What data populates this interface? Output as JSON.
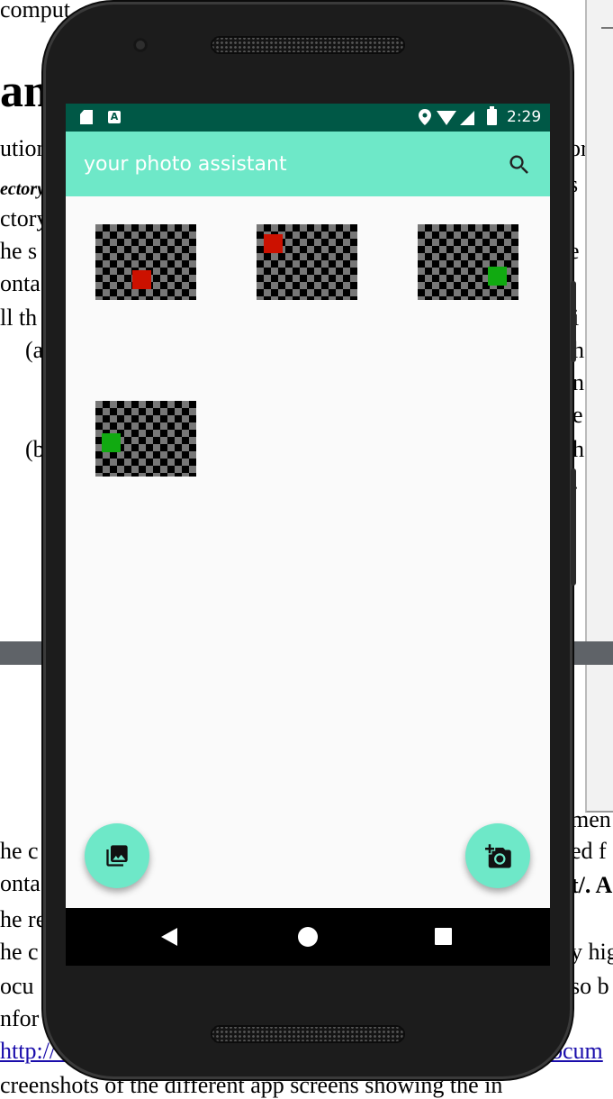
{
  "background_document": {
    "top_fragment": "comput",
    "title_fragment": "an",
    "left_lines": [
      "ution",
      "ectory",
      "ctory",
      "he s",
      "onta",
      "ll th",
      "(a",
      "(b"
    ],
    "right_lines": [
      "or",
      "s",
      "e",
      "i",
      "h",
      "n",
      "e",
      "h",
      "."
    ],
    "bottom_left_lines": [
      "he c",
      "onta",
      "he re",
      "he c",
      "ocu",
      "nfor"
    ],
    "bottom_right_lines": [
      "men",
      "ed f",
      "t/. A",
      "y hig",
      "so b"
    ],
    "link_fragment_left": "http://v",
    "link_fragment_right": "ocum",
    "bottom_line": "creenshots of the different app screens showing the in"
  },
  "status_bar": {
    "time": "2:29",
    "a_badge": "A",
    "background": "#005846",
    "icons": [
      "sd-card-icon",
      "a-notification-icon",
      "location-icon",
      "wifi-icon",
      "cell-signal-icon",
      "battery-charging-icon"
    ]
  },
  "app_bar": {
    "title": "your photo assistant",
    "background": "#6ee8c8",
    "action_icon": "search-icon"
  },
  "photos": [
    {
      "marker_color": "#cc1100"
    },
    {
      "marker_color": "#cc1100"
    },
    {
      "marker_color": "#11aa11"
    },
    {
      "marker_color": "#11aa11"
    }
  ],
  "fabs": {
    "gallery": {
      "icon": "photo-library-icon",
      "color": "#6ee8c8"
    },
    "camera": {
      "icon": "add-a-photo-icon",
      "color": "#6ee8c8"
    }
  },
  "nav_bar": {
    "icons": [
      "back-icon",
      "home-icon",
      "recents-icon"
    ]
  }
}
